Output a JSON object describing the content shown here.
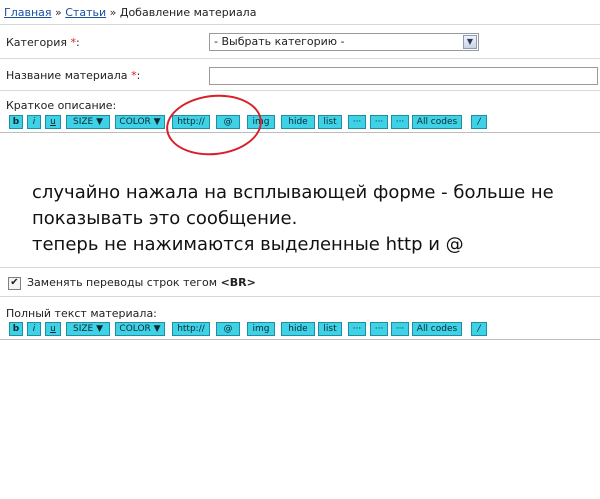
{
  "breadcrumb": {
    "home": "Главная",
    "sep1": "»",
    "articles": "Статьи",
    "sep2": "»",
    "current": "Добавление материала"
  },
  "category": {
    "label": "Категория",
    "required_mark": "*",
    "colon": ":",
    "selected": "- Выбрать категорию -"
  },
  "title_field": {
    "label": "Название материала",
    "required_mark": "*",
    "colon": ":",
    "value": ""
  },
  "short_desc": {
    "label": "Краткое описание:"
  },
  "full_text": {
    "label": "Полный текст материала:"
  },
  "toolbar": {
    "b": "b",
    "i": "i",
    "u": "u",
    "size": "SIZE ▼",
    "color": "COLOR ▼",
    "http": "http://",
    "at": "@",
    "img": "img",
    "hide": "hide",
    "list": "list",
    "dots1": "···",
    "dots2": "···",
    "dots3": "···",
    "all": "All codes",
    "slash": "/"
  },
  "linebreaks": {
    "label_prefix": "Заменять переводы строк тегом ",
    "tag": "<BR>",
    "checked": true,
    "checkmark": "✔"
  },
  "annotation": {
    "line1": "случайно нажала на всплывающей форме - больше не",
    "line2": "показывать это сообщение.",
    "line3": "теперь не нажимаются выделенные http и @"
  },
  "colors": {
    "toolbar_button": "#3fd2e6",
    "link": "#1a4fa3",
    "required": "#e01818",
    "circle": "#d8202a"
  }
}
